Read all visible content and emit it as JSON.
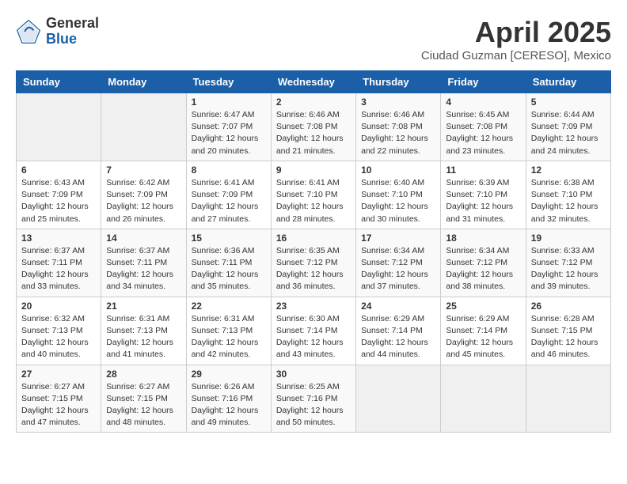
{
  "header": {
    "logo_general": "General",
    "logo_blue": "Blue",
    "month": "April 2025",
    "location": "Ciudad Guzman [CERESO], Mexico"
  },
  "weekdays": [
    "Sunday",
    "Monday",
    "Tuesday",
    "Wednesday",
    "Thursday",
    "Friday",
    "Saturday"
  ],
  "weeks": [
    [
      {
        "day": "",
        "sunrise": "",
        "sunset": "",
        "daylight": ""
      },
      {
        "day": "",
        "sunrise": "",
        "sunset": "",
        "daylight": ""
      },
      {
        "day": "1",
        "sunrise": "Sunrise: 6:47 AM",
        "sunset": "Sunset: 7:07 PM",
        "daylight": "Daylight: 12 hours and 20 minutes."
      },
      {
        "day": "2",
        "sunrise": "Sunrise: 6:46 AM",
        "sunset": "Sunset: 7:08 PM",
        "daylight": "Daylight: 12 hours and 21 minutes."
      },
      {
        "day": "3",
        "sunrise": "Sunrise: 6:46 AM",
        "sunset": "Sunset: 7:08 PM",
        "daylight": "Daylight: 12 hours and 22 minutes."
      },
      {
        "day": "4",
        "sunrise": "Sunrise: 6:45 AM",
        "sunset": "Sunset: 7:08 PM",
        "daylight": "Daylight: 12 hours and 23 minutes."
      },
      {
        "day": "5",
        "sunrise": "Sunrise: 6:44 AM",
        "sunset": "Sunset: 7:09 PM",
        "daylight": "Daylight: 12 hours and 24 minutes."
      }
    ],
    [
      {
        "day": "6",
        "sunrise": "Sunrise: 6:43 AM",
        "sunset": "Sunset: 7:09 PM",
        "daylight": "Daylight: 12 hours and 25 minutes."
      },
      {
        "day": "7",
        "sunrise": "Sunrise: 6:42 AM",
        "sunset": "Sunset: 7:09 PM",
        "daylight": "Daylight: 12 hours and 26 minutes."
      },
      {
        "day": "8",
        "sunrise": "Sunrise: 6:41 AM",
        "sunset": "Sunset: 7:09 PM",
        "daylight": "Daylight: 12 hours and 27 minutes."
      },
      {
        "day": "9",
        "sunrise": "Sunrise: 6:41 AM",
        "sunset": "Sunset: 7:10 PM",
        "daylight": "Daylight: 12 hours and 28 minutes."
      },
      {
        "day": "10",
        "sunrise": "Sunrise: 6:40 AM",
        "sunset": "Sunset: 7:10 PM",
        "daylight": "Daylight: 12 hours and 30 minutes."
      },
      {
        "day": "11",
        "sunrise": "Sunrise: 6:39 AM",
        "sunset": "Sunset: 7:10 PM",
        "daylight": "Daylight: 12 hours and 31 minutes."
      },
      {
        "day": "12",
        "sunrise": "Sunrise: 6:38 AM",
        "sunset": "Sunset: 7:10 PM",
        "daylight": "Daylight: 12 hours and 32 minutes."
      }
    ],
    [
      {
        "day": "13",
        "sunrise": "Sunrise: 6:37 AM",
        "sunset": "Sunset: 7:11 PM",
        "daylight": "Daylight: 12 hours and 33 minutes."
      },
      {
        "day": "14",
        "sunrise": "Sunrise: 6:37 AM",
        "sunset": "Sunset: 7:11 PM",
        "daylight": "Daylight: 12 hours and 34 minutes."
      },
      {
        "day": "15",
        "sunrise": "Sunrise: 6:36 AM",
        "sunset": "Sunset: 7:11 PM",
        "daylight": "Daylight: 12 hours and 35 minutes."
      },
      {
        "day": "16",
        "sunrise": "Sunrise: 6:35 AM",
        "sunset": "Sunset: 7:12 PM",
        "daylight": "Daylight: 12 hours and 36 minutes."
      },
      {
        "day": "17",
        "sunrise": "Sunrise: 6:34 AM",
        "sunset": "Sunset: 7:12 PM",
        "daylight": "Daylight: 12 hours and 37 minutes."
      },
      {
        "day": "18",
        "sunrise": "Sunrise: 6:34 AM",
        "sunset": "Sunset: 7:12 PM",
        "daylight": "Daylight: 12 hours and 38 minutes."
      },
      {
        "day": "19",
        "sunrise": "Sunrise: 6:33 AM",
        "sunset": "Sunset: 7:12 PM",
        "daylight": "Daylight: 12 hours and 39 minutes."
      }
    ],
    [
      {
        "day": "20",
        "sunrise": "Sunrise: 6:32 AM",
        "sunset": "Sunset: 7:13 PM",
        "daylight": "Daylight: 12 hours and 40 minutes."
      },
      {
        "day": "21",
        "sunrise": "Sunrise: 6:31 AM",
        "sunset": "Sunset: 7:13 PM",
        "daylight": "Daylight: 12 hours and 41 minutes."
      },
      {
        "day": "22",
        "sunrise": "Sunrise: 6:31 AM",
        "sunset": "Sunset: 7:13 PM",
        "daylight": "Daylight: 12 hours and 42 minutes."
      },
      {
        "day": "23",
        "sunrise": "Sunrise: 6:30 AM",
        "sunset": "Sunset: 7:14 PM",
        "daylight": "Daylight: 12 hours and 43 minutes."
      },
      {
        "day": "24",
        "sunrise": "Sunrise: 6:29 AM",
        "sunset": "Sunset: 7:14 PM",
        "daylight": "Daylight: 12 hours and 44 minutes."
      },
      {
        "day": "25",
        "sunrise": "Sunrise: 6:29 AM",
        "sunset": "Sunset: 7:14 PM",
        "daylight": "Daylight: 12 hours and 45 minutes."
      },
      {
        "day": "26",
        "sunrise": "Sunrise: 6:28 AM",
        "sunset": "Sunset: 7:15 PM",
        "daylight": "Daylight: 12 hours and 46 minutes."
      }
    ],
    [
      {
        "day": "27",
        "sunrise": "Sunrise: 6:27 AM",
        "sunset": "Sunset: 7:15 PM",
        "daylight": "Daylight: 12 hours and 47 minutes."
      },
      {
        "day": "28",
        "sunrise": "Sunrise: 6:27 AM",
        "sunset": "Sunset: 7:15 PM",
        "daylight": "Daylight: 12 hours and 48 minutes."
      },
      {
        "day": "29",
        "sunrise": "Sunrise: 6:26 AM",
        "sunset": "Sunset: 7:16 PM",
        "daylight": "Daylight: 12 hours and 49 minutes."
      },
      {
        "day": "30",
        "sunrise": "Sunrise: 6:25 AM",
        "sunset": "Sunset: 7:16 PM",
        "daylight": "Daylight: 12 hours and 50 minutes."
      },
      {
        "day": "",
        "sunrise": "",
        "sunset": "",
        "daylight": ""
      },
      {
        "day": "",
        "sunrise": "",
        "sunset": "",
        "daylight": ""
      },
      {
        "day": "",
        "sunrise": "",
        "sunset": "",
        "daylight": ""
      }
    ]
  ]
}
